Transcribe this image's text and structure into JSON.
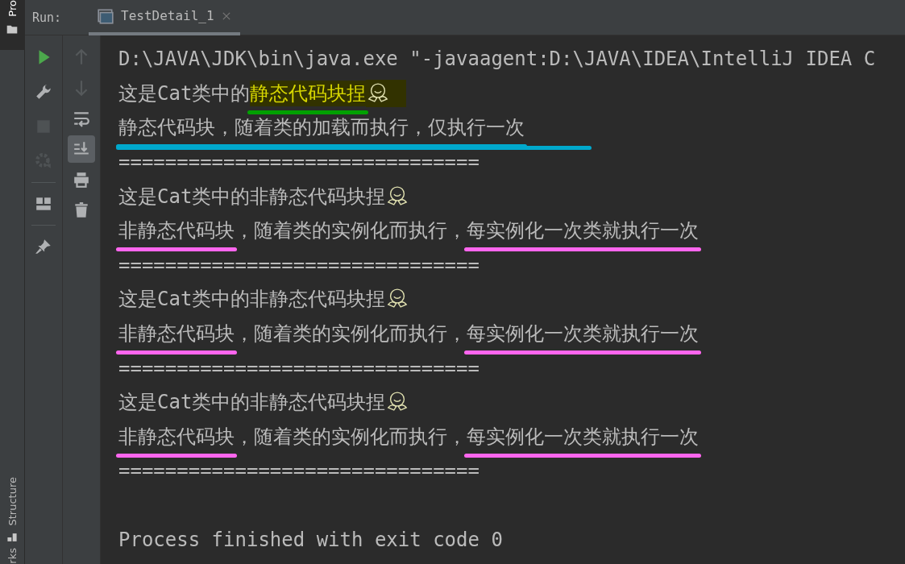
{
  "left_strip": {
    "top_tab": {
      "label": "Pro",
      "selected": true
    },
    "bottom_tabs": [
      {
        "label": "Structure",
        "selected": false
      },
      {
        "label": "rks",
        "selected": false
      }
    ]
  },
  "run_bar": {
    "label": "Run:",
    "tabs": [
      {
        "label": "TestDetail_1",
        "selected": true
      }
    ]
  },
  "toolbar_1": [
    {
      "disabled": false
    },
    {
      "disabled": false
    },
    {
      "disabled": true
    },
    {
      "disabled": true
    },
    {
      "separator": true
    },
    {
      "disabled": false
    },
    {
      "separator": true
    },
    {
      "disabled": false
    }
  ],
  "toolbar_2": [
    {
      "disabled": true,
      "selected": false
    },
    {
      "disabled": true,
      "selected": false
    },
    {
      "disabled": false,
      "selected": false
    },
    {
      "disabled": false,
      "selected": true
    },
    {
      "disabled": false,
      "selected": false
    },
    {
      "disabled": false,
      "selected": false
    }
  ],
  "console": [
    {
      "kind": "text",
      "segments": [
        {
          "text": "D:\\JAVA\\JDK\\bin\\java.exe \"-javaagent:D:\\JAVA\\IDEA\\IntelliJ IDEA C"
        }
      ]
    },
    {
      "kind": "text",
      "emoji": true,
      "segments": [
        {
          "text": "这是Cat类中的"
        },
        {
          "text": "静态代码块捏",
          "highlighted": true,
          "underline": {
            "color": "#00a000"
          }
        }
      ]
    },
    {
      "kind": "text",
      "rule": {
        "color": "#00a8cc"
      },
      "segments": [
        {
          "text": "静态代码块，随着类的加载而执行，仅执行一次",
          "underline": {
            "color": "#00a8cc"
          }
        }
      ]
    },
    {
      "kind": "text",
      "segments": [
        {
          "text": "==============================="
        }
      ]
    },
    {
      "kind": "text",
      "emoji": true,
      "segments": [
        {
          "text": "这是Cat类中的非静态代码块捏"
        }
      ]
    },
    {
      "kind": "text",
      "segments": [
        {
          "text": "非静态代码块",
          "underline": {
            "color": "#ff66ee"
          }
        },
        {
          "text": "，随着类的实例化而执行，"
        },
        {
          "text": "每实例化一次类就执行一次",
          "underline": {
            "color": "#ff66ee"
          }
        }
      ]
    },
    {
      "kind": "text",
      "segments": [
        {
          "text": "==============================="
        }
      ]
    },
    {
      "kind": "text",
      "emoji": true,
      "segments": [
        {
          "text": "这是Cat类中的非静态代码块捏"
        }
      ]
    },
    {
      "kind": "text",
      "segments": [
        {
          "text": "非静态代码块",
          "underline": {
            "color": "#ff66ee"
          }
        },
        {
          "text": "，随着类的实例化而执行，"
        },
        {
          "text": "每实例化一次类就执行一次",
          "underline": {
            "color": "#ff66ee"
          }
        }
      ]
    },
    {
      "kind": "text",
      "segments": [
        {
          "text": "==============================="
        }
      ]
    },
    {
      "kind": "text",
      "emoji": true,
      "segments": [
        {
          "text": "这是Cat类中的非静态代码块捏"
        }
      ]
    },
    {
      "kind": "text",
      "segments": [
        {
          "text": "非静态代码块",
          "underline": {
            "color": "#ff66ee"
          }
        },
        {
          "text": "，随着类的实例化而执行，"
        },
        {
          "text": "每实例化一次类就执行一次",
          "underline": {
            "color": "#ff66ee"
          }
        }
      ]
    },
    {
      "kind": "text",
      "segments": [
        {
          "text": "==============================="
        }
      ]
    },
    {
      "kind": "blank"
    },
    {
      "kind": "text",
      "segments": [
        {
          "text": "Process finished with exit code 0"
        }
      ]
    }
  ]
}
